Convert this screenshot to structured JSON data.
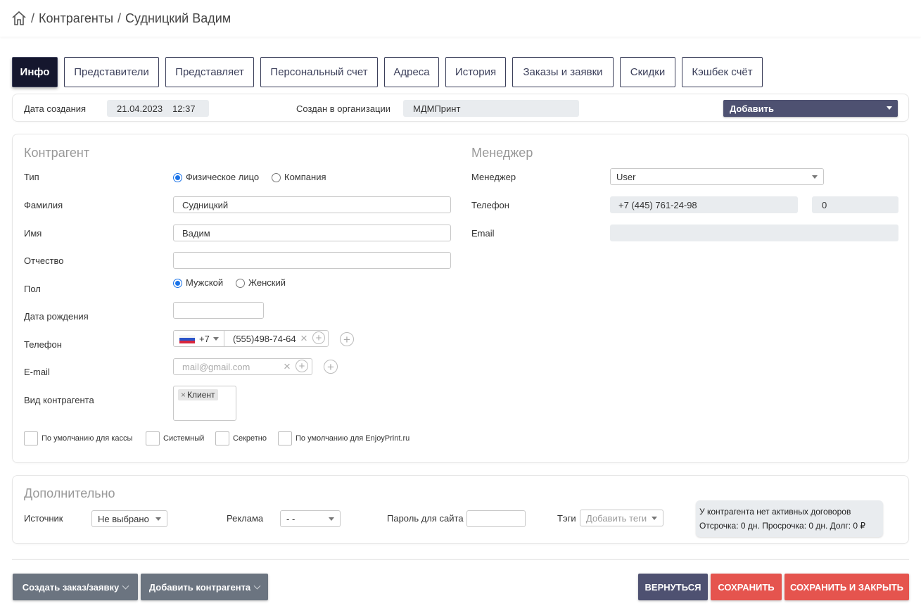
{
  "breadcrumb": {
    "sep": "/",
    "items": [
      "Контрагенты",
      "Судницкий Вадим"
    ]
  },
  "tabs": [
    "Инфо",
    "Представители",
    "Представляет",
    "Персональный счет",
    "Адреса",
    "История",
    "Заказы и заявки",
    "Скидки",
    "Кэшбек счёт"
  ],
  "meta": {
    "created_label": "Дата создания",
    "created_date": "21.04.2023",
    "created_time": "12:37",
    "org_label": "Создан в организации",
    "org_value": "МДМПринт",
    "add_label": "Добавить"
  },
  "contractor": {
    "title": "Контрагент",
    "type_label": "Тип",
    "type_options": [
      "Физическое лицо",
      "Компания"
    ],
    "lastname_label": "Фамилия",
    "lastname_value": "Судницкий",
    "firstname_label": "Имя",
    "firstname_value": "Вадим",
    "middlename_label": "Отчество",
    "middlename_value": "",
    "gender_label": "Пол",
    "gender_options": [
      "Мужской",
      "Женский"
    ],
    "birthdate_label": "Дата рождения",
    "phone_label": "Телефон",
    "phone_code": "+7",
    "phone_value": "(555)498-74-64",
    "email_label": "E-mail",
    "email_placeholder": "mail@gmail.com",
    "kind_label": "Вид контрагента",
    "kind_tag": "Клиент",
    "checkboxes": [
      "По умолчанию для кассы",
      "Системный",
      "Секретно",
      "По умолчанию для EnjoyPrint.ru"
    ]
  },
  "manager": {
    "title": "Менеджер",
    "manager_label": "Менеджер",
    "manager_value": "User",
    "phone_label": "Телефон",
    "phone_value": "+7 (445) 761-24-98",
    "phone_ext": "0",
    "email_label": "Email",
    "email_value": ""
  },
  "extra": {
    "title": "Дополнительно",
    "source_label": "Источник",
    "source_value": "Не выбрано",
    "ad_label": "Реклама",
    "ad_value": "- -",
    "password_label": "Пароль для сайта",
    "tags_label": "Тэги",
    "tags_placeholder": "Добавить теги",
    "contract_line1": "У контрагента нет активных договоров",
    "contract_line2": "Отсрочка: 0 дн. Просрочка: 0 дн. Долг: 0 ₽"
  },
  "footer": {
    "create_order": "Создать заказ/заявку",
    "add_contractor": "Добавить контрагента",
    "back": "ВЕРНУТЬСЯ",
    "save": "СОХРАНИТЬ",
    "save_close": "СОХРАНИТЬ И ЗАКРЫТЬ"
  },
  "colors": {
    "accent_dark": "#15172e",
    "navy": "#4e5171",
    "red": "#e5544e",
    "gray_btn": "#6b7480"
  }
}
